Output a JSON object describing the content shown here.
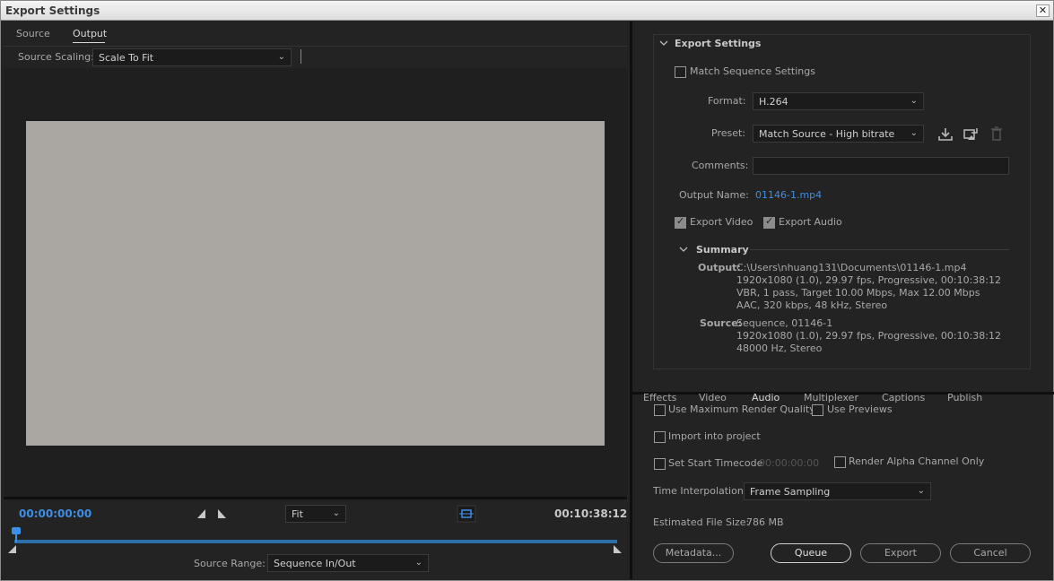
{
  "window": {
    "title": "Export Settings",
    "close_glyph": "✕"
  },
  "left": {
    "tabs": [
      {
        "label": "Source"
      },
      {
        "label": "Output"
      }
    ],
    "source_scaling_label": "Source Scaling:",
    "source_scaling_value": "Scale To Fit",
    "tc_in": "00:00:00:00",
    "tc_out": "00:10:38:12",
    "zoom_value": "Fit",
    "source_range_label": "Source Range:",
    "source_range_value": "Sequence In/Out"
  },
  "right": {
    "section_title": "Export Settings",
    "match_sequence_label": "Match Sequence Settings",
    "format_label": "Format:",
    "format_value": "H.264",
    "preset_label": "Preset:",
    "preset_value": "Match Source - High bitrate",
    "comments_label": "Comments:",
    "output_name_label": "Output Name:",
    "output_name_value": "01146-1.mp4",
    "export_video_label": "Export Video",
    "export_audio_label": "Export Audio",
    "summary_title": "Summary",
    "summary": {
      "output_label": "Output:",
      "output_lines": [
        "C:\\Users\\nhuang131\\Documents\\01146-1.mp4",
        "1920x1080 (1.0), 29.97 fps, Progressive, 00:10:38:12",
        "VBR, 1 pass, Target 10.00 Mbps, Max 12.00 Mbps",
        "AAC, 320 kbps, 48 kHz, Stereo"
      ],
      "source_label": "Source:",
      "source_lines": [
        "Sequence, 01146-1",
        "1920x1080 (1.0), 29.97 fps, Progressive, 00:10:38:12",
        "48000 Hz, Stereo"
      ]
    },
    "bottom_tabs": [
      {
        "label": "Effects"
      },
      {
        "label": "Video"
      },
      {
        "label": "Audio"
      },
      {
        "label": "Multiplexer"
      },
      {
        "label": "Captions"
      },
      {
        "label": "Publish"
      }
    ],
    "use_max_render_label": "Use Maximum Render Quality",
    "use_previews_label": "Use Previews",
    "import_into_project_label": "Import into project",
    "set_start_timecode_label": "Set Start Timecode",
    "start_timecode_value": "00:00:00:00",
    "render_alpha_label": "Render Alpha Channel Only",
    "time_interp_label": "Time Interpolation:",
    "time_interp_value": "Frame Sampling",
    "est_file_size_label": "Estimated File Size:",
    "est_file_size_value": "786 MB",
    "buttons": {
      "metadata": "Metadata...",
      "queue": "Queue",
      "export": "Export",
      "cancel": "Cancel"
    }
  },
  "colors": {
    "accent": "#3d8ee6",
    "timeline": "#2d6fa8",
    "bg": "#232323"
  }
}
